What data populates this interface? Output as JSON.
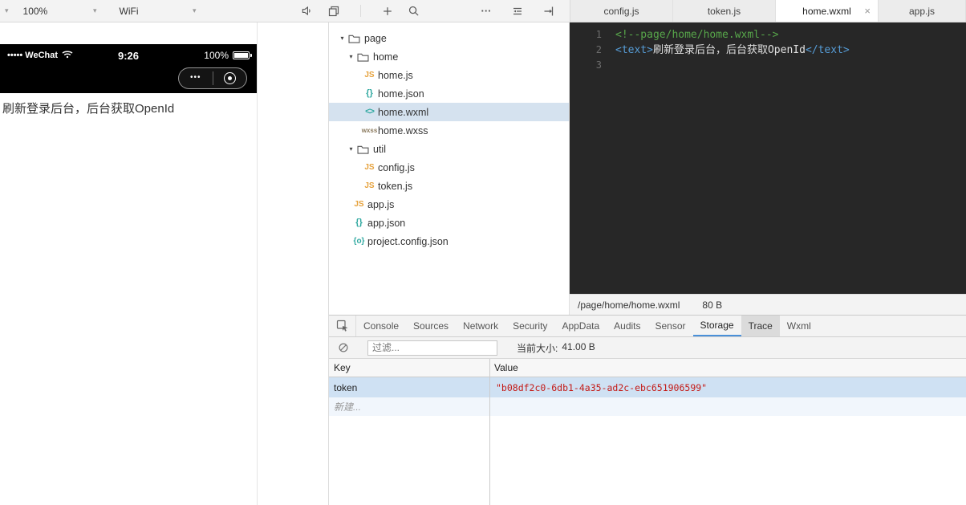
{
  "icons": {
    "caret_down": "▾",
    "tree_caret": "▾",
    "more": "···",
    "close": "×",
    "file_js": "JS",
    "file_json": "{}",
    "file_wxml": "<>",
    "file_wxss": "wxss",
    "file_config": "{o}",
    "menu_dots": "•••",
    "carrier": "••••• WeChat"
  },
  "toolbar": {
    "zoom": "100%",
    "network": "WiFi"
  },
  "editor_tabs": [
    {
      "label": "config.js"
    },
    {
      "label": "token.js"
    },
    {
      "label": "home.wxml",
      "active": true
    },
    {
      "label": "app.js"
    }
  ],
  "simulator": {
    "time": "9:26",
    "battery": "100%",
    "content": "刷新登录后台，后台获取OpenId"
  },
  "filetree": {
    "items": [
      {
        "label": "page"
      },
      {
        "label": "home"
      },
      {
        "label": "home.js"
      },
      {
        "label": "home.json"
      },
      {
        "label": "home.wxml"
      },
      {
        "label": "home.wxss"
      },
      {
        "label": "util"
      },
      {
        "label": "config.js"
      },
      {
        "label": "token.js"
      },
      {
        "label": "app.js"
      },
      {
        "label": "app.json"
      },
      {
        "label": "project.config.json"
      }
    ]
  },
  "editor": {
    "lines": [
      {
        "no": "1",
        "tokens": [
          {
            "text": "<!--page/home/home.wxml-->",
            "type": "comment"
          }
        ]
      },
      {
        "no": "2",
        "tokens": [
          {
            "text": "<text>",
            "type": "tag"
          },
          {
            "text": "刷新登录后台，后台获取OpenId",
            "type": "plain"
          },
          {
            "text": "</text>",
            "type": "tag"
          }
        ]
      },
      {
        "no": "3",
        "tokens": []
      }
    ],
    "status_path": "/page/home/home.wxml",
    "status_size": "80 B"
  },
  "devtools": {
    "tabs": [
      "Console",
      "Sources",
      "Network",
      "Security",
      "AppData",
      "Audits",
      "Sensor",
      "Storage",
      "Trace",
      "Wxml"
    ],
    "filter_placeholder": "过滤...",
    "size_label": "当前大小:",
    "size_value": "41.00 B",
    "table": {
      "col_key": "Key",
      "col_value": "Value",
      "rows": [
        {
          "key": "token",
          "value": "\"b08df2c0-6db1-4a35-ad2c-ebc651906599\""
        }
      ],
      "new_row_label": "新建..."
    }
  }
}
